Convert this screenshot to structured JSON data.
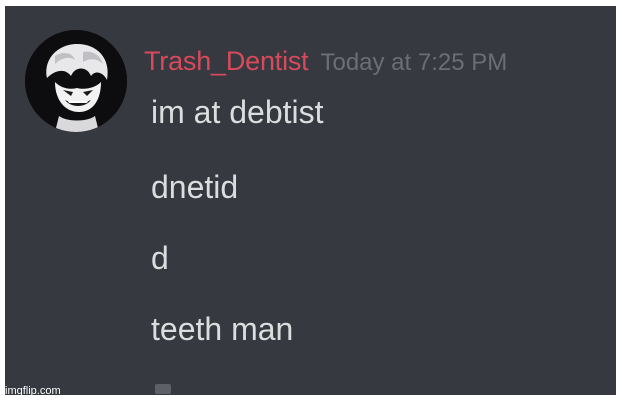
{
  "message": {
    "username": "Trash_Dentist",
    "timestamp": "Today at 7:25 PM",
    "lines": [
      "im at debtist",
      "dnetid",
      "d",
      "teeth man"
    ]
  },
  "watermark": "imgflip.com",
  "colors": {
    "background": "#36393f",
    "username": "#d64a5b",
    "timestamp": "#6b6e74",
    "text": "#dcddde"
  }
}
